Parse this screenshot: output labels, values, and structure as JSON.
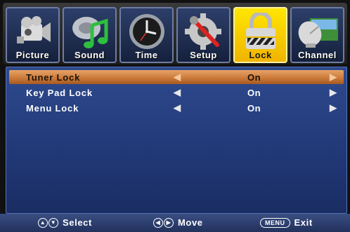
{
  "tabs": [
    {
      "label": "Picture",
      "icon": "camcorder-icon",
      "active": false
    },
    {
      "label": "Sound",
      "icon": "music-note-icon",
      "active": false
    },
    {
      "label": "Time",
      "icon": "clock-icon",
      "active": false
    },
    {
      "label": "Setup",
      "icon": "gear-wrench-icon",
      "active": false
    },
    {
      "label": "Lock",
      "icon": "padlock-icon",
      "active": true
    },
    {
      "label": "Channel",
      "icon": "satellite-dish-icon",
      "active": false
    }
  ],
  "menu": {
    "rows": [
      {
        "name": "Tuner Lock",
        "value": "On",
        "selected": true,
        "left_arrow": "◀",
        "right_arrow": "▶"
      },
      {
        "name": "Key Pad Lock",
        "value": "On",
        "selected": false,
        "left_arrow": "◀",
        "right_arrow": "▶"
      },
      {
        "name": "Menu Lock",
        "value": "On",
        "selected": false,
        "left_arrow": "◀",
        "right_arrow": "▶"
      }
    ]
  },
  "help": {
    "select_label": "Select",
    "move_label": "Move",
    "menu_key": "MENU",
    "exit_label": "Exit",
    "up_key": "▲",
    "down_key": "▼",
    "left_key": "◀",
    "right_key": "▶"
  },
  "colors": {
    "active_tab": "#ffd800",
    "panel": "#27408a",
    "selected_row": "#d08040"
  }
}
